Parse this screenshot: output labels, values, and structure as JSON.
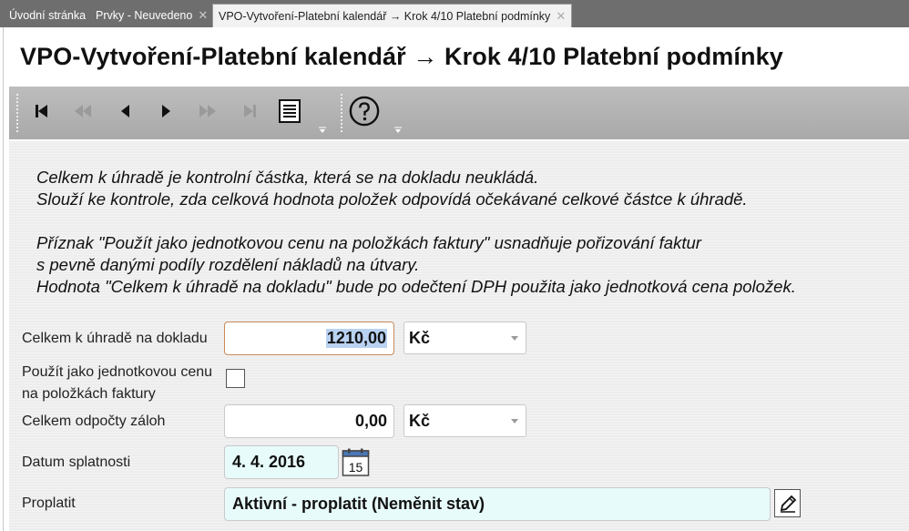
{
  "tabs": [
    {
      "label": "Úvodní stránka",
      "closable": false
    },
    {
      "label": "Prvky - Neuvedeno",
      "closable": true
    },
    {
      "label": "VPO-Vytvoření-Platební kalendář → Krok 4/10 Platební podmínky",
      "closable": true,
      "active": true
    }
  ],
  "tab_close_glyph": "✕",
  "page_title": "VPO-Vytvoření-Platební kalendář → Krok 4/10 Platební podmínky",
  "toolbar": {
    "buttons": [
      {
        "name": "first-record",
        "icon": "first-icon",
        "enabled": true
      },
      {
        "name": "fast-back",
        "icon": "fast-back-icon",
        "enabled": false
      },
      {
        "name": "previous",
        "icon": "prev-icon",
        "enabled": true
      },
      {
        "name": "next",
        "icon": "next-icon",
        "enabled": true
      },
      {
        "name": "fast-forward",
        "icon": "fast-forward-icon",
        "enabled": false
      },
      {
        "name": "last-record",
        "icon": "last-icon",
        "enabled": false
      },
      {
        "name": "list",
        "icon": "list-icon",
        "enabled": true
      },
      {
        "name": "help",
        "icon": "help-icon",
        "enabled": true
      }
    ]
  },
  "info": {
    "line1": "Celkem k úhradě je kontrolní částka, která se na dokladu neukládá.",
    "line2": "Slouží ke kontrole, zda celková hodnota položek odpovídá očekávané celkové částce k úhradě.",
    "line3": "Příznak \"Použít jako jednotkovou cenu na položkách faktury\" usnadňuje pořizování faktur",
    "line4": "s pevně danými podíly rozdělení nákladů na útvary.",
    "line5": "Hodnota \"Celkem k úhradě na dokladu\" bude po odečtení DPH použita jako jednotková cena položek."
  },
  "form": {
    "total": {
      "label": "Celkem k úhradě na dokladu",
      "value": "1210,00",
      "currency": "Kč"
    },
    "use_unit_price": {
      "label_line1": "Použít jako jednotkovou cenu",
      "label_line2": "na položkách faktury",
      "checked": false
    },
    "advance_deductions": {
      "label": "Celkem odpočty záloh",
      "value": "0,00",
      "currency": "Kč"
    },
    "due_date": {
      "label": "Datum splatnosti",
      "value": "4. 4. 2016",
      "calendar_day": "15"
    },
    "payment": {
      "label": "Proplatit",
      "value": "Aktivní - proplatit (Neměnit stav)"
    }
  },
  "colors": {
    "toolbar": "#b3b3b3",
    "tabbar": "#6e6e6e",
    "readonly_field": "#e8fbfb",
    "selection": "#b9d2f2"
  }
}
